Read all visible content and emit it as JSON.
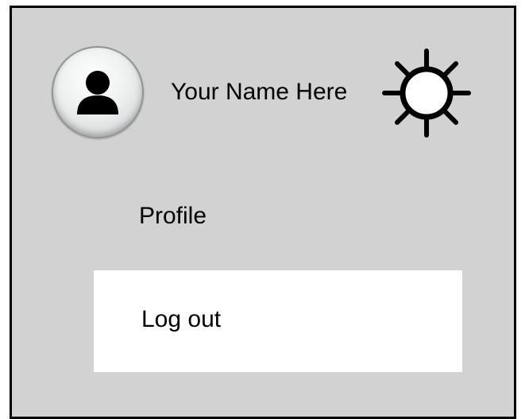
{
  "user": {
    "name": "Your Name Here",
    "avatar_icon": "user-silhouette-icon"
  },
  "header": {
    "settings_icon": "gear-icon"
  },
  "menu": {
    "items": [
      {
        "label": "Profile",
        "highlighted": false
      },
      {
        "label": "Log out",
        "highlighted": true
      }
    ]
  },
  "colors": {
    "panel_background": "#d2d2d2",
    "highlight_background": "#ffffff",
    "border": "#000000"
  }
}
